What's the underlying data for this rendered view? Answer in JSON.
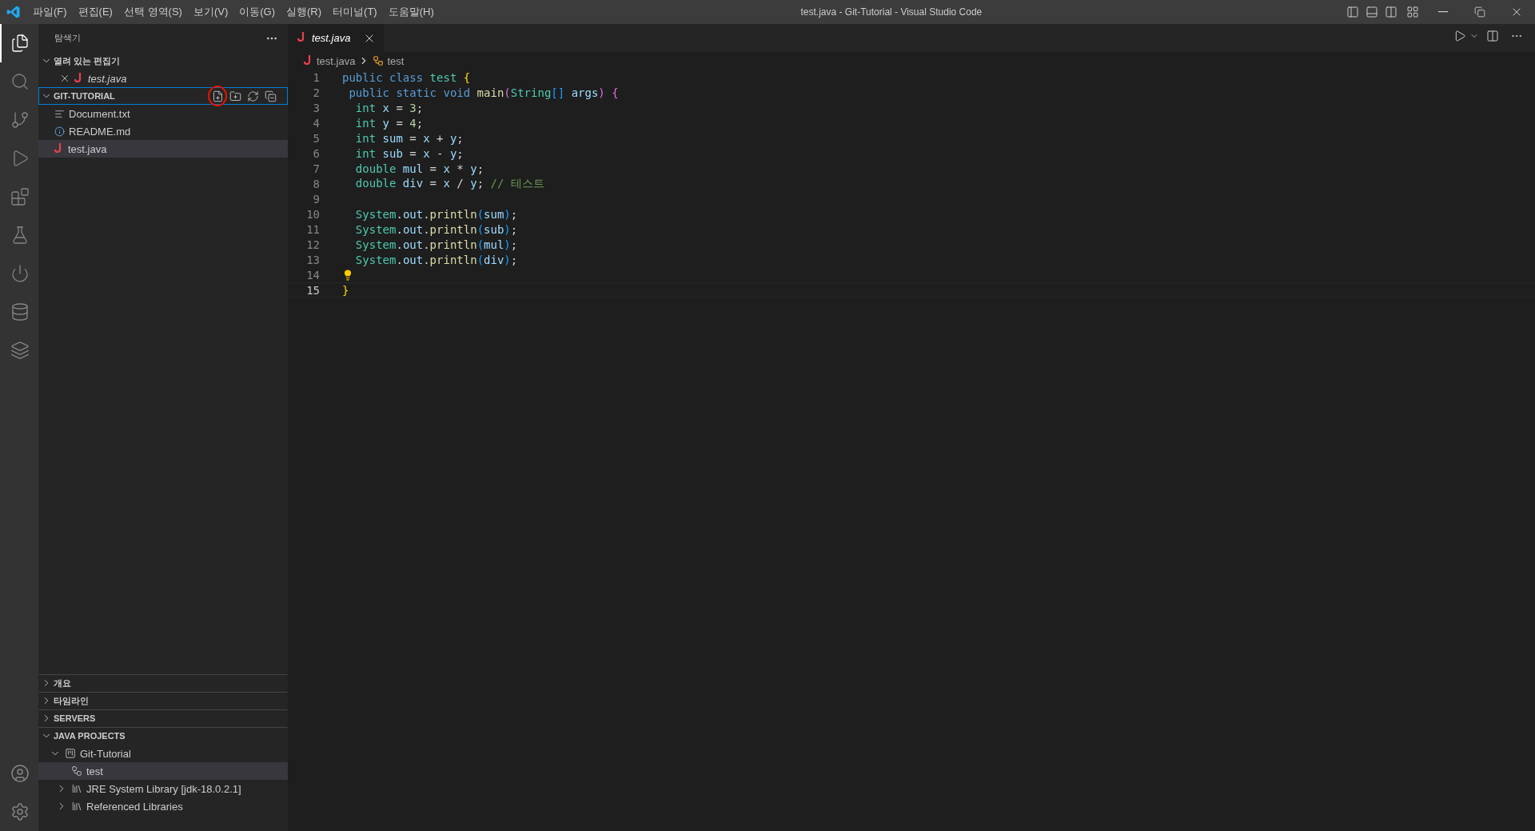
{
  "window": {
    "title": "test.java - Git-Tutorial - Visual Studio Code"
  },
  "menu": [
    "파일(F)",
    "편집(E)",
    "선택 영역(S)",
    "보기(V)",
    "이동(G)",
    "실행(R)",
    "터미널(T)",
    "도움말(H)"
  ],
  "activity_bar": {
    "items": [
      {
        "selected": true
      },
      {
        "selected": false
      },
      {
        "selected": false
      },
      {
        "selected": false
      },
      {
        "selected": false
      },
      {
        "selected": false
      },
      {
        "selected": false
      },
      {
        "selected": false
      },
      {
        "selected": false
      }
    ]
  },
  "sidebar": {
    "title": "탐색기",
    "open_editors": {
      "label": "열려 있는 편집기",
      "expanded": true,
      "files": [
        {
          "name": "test.java",
          "kind": "java",
          "preview": true
        }
      ]
    },
    "folder": {
      "label": "GIT-TUTORIAL",
      "expanded": true,
      "focused": true,
      "actions": [
        {
          "highlighted": true
        },
        {
          "highlighted": false
        },
        {
          "highlighted": false
        },
        {
          "highlighted": false
        }
      ],
      "files": [
        {
          "name": "Document.txt",
          "kind": "text",
          "selected": false
        },
        {
          "name": "README.md",
          "kind": "info",
          "selected": false
        },
        {
          "name": "test.java",
          "kind": "java",
          "selected": true
        }
      ]
    },
    "panels": [
      {
        "label": "개요",
        "expanded": false
      },
      {
        "label": "타임라인",
        "expanded": false
      },
      {
        "label": "SERVERS",
        "expanded": false
      },
      {
        "label": "JAVA PROJECTS",
        "expanded": true,
        "tree": [
          {
            "name": "Git-Tutorial",
            "kind": "project",
            "expanded": true,
            "selected": false,
            "children": [
              {
                "name": "test",
                "kind": "class",
                "selected": true
              },
              {
                "name": "JRE System Library [jdk-18.0.2.1]",
                "kind": "library",
                "expanded": false,
                "selected": false
              },
              {
                "name": "Referenced Libraries",
                "kind": "library",
                "expanded": false,
                "selected": false
              }
            ]
          }
        ]
      }
    ]
  },
  "editor": {
    "tabs": [
      {
        "label": "test.java",
        "selected": true,
        "preview": true
      }
    ],
    "breadcrumb": [
      "test.java",
      "test"
    ],
    "lines": [
      {
        "number": "1",
        "tokens": [
          {
            "text": "public ",
            "kind": "keyword"
          },
          {
            "text": "class ",
            "kind": "keyword"
          },
          {
            "text": "test ",
            "kind": "type"
          },
          {
            "text": "{",
            "kind": "bracket1"
          }
        ]
      },
      {
        "number": "2",
        "tokens": [
          {
            "text": " public ",
            "kind": "keyword"
          },
          {
            "text": "static ",
            "kind": "keyword"
          },
          {
            "text": "void ",
            "kind": "keyword"
          },
          {
            "text": "main",
            "kind": "function"
          },
          {
            "text": "(",
            "kind": "bracket2"
          },
          {
            "text": "String",
            "kind": "type"
          },
          {
            "text": "[]",
            "kind": "bracket3"
          },
          {
            "text": " args",
            "kind": "variable"
          },
          {
            "text": ") {",
            "kind": "bracket2"
          }
        ]
      },
      {
        "number": "3",
        "tokens": [
          {
            "text": "  int ",
            "kind": "type"
          },
          {
            "text": "x",
            "kind": "variable"
          },
          {
            "text": " = ",
            "kind": "plain"
          },
          {
            "text": "3",
            "kind": "number"
          },
          {
            "text": ";",
            "kind": "plain"
          }
        ]
      },
      {
        "number": "4",
        "tokens": [
          {
            "text": "  int ",
            "kind": "type"
          },
          {
            "text": "y",
            "kind": "variable"
          },
          {
            "text": " = ",
            "kind": "plain"
          },
          {
            "text": "4",
            "kind": "number"
          },
          {
            "text": ";",
            "kind": "plain"
          }
        ]
      },
      {
        "number": "5",
        "tokens": [
          {
            "text": "  int ",
            "kind": "type"
          },
          {
            "text": "sum",
            "kind": "variable"
          },
          {
            "text": " = ",
            "kind": "plain"
          },
          {
            "text": "x",
            "kind": "variable"
          },
          {
            "text": " + ",
            "kind": "plain"
          },
          {
            "text": "y",
            "kind": "variable"
          },
          {
            "text": ";",
            "kind": "plain"
          }
        ]
      },
      {
        "number": "6",
        "tokens": [
          {
            "text": "  int ",
            "kind": "type"
          },
          {
            "text": "sub",
            "kind": "variable"
          },
          {
            "text": " = ",
            "kind": "plain"
          },
          {
            "text": "x",
            "kind": "variable"
          },
          {
            "text": " - ",
            "kind": "plain"
          },
          {
            "text": "y",
            "kind": "variable"
          },
          {
            "text": ";",
            "kind": "plain"
          }
        ]
      },
      {
        "number": "7",
        "tokens": [
          {
            "text": "  double ",
            "kind": "type"
          },
          {
            "text": "mul",
            "kind": "variable"
          },
          {
            "text": " = ",
            "kind": "plain"
          },
          {
            "text": "x",
            "kind": "variable"
          },
          {
            "text": " * ",
            "kind": "plain"
          },
          {
            "text": "y",
            "kind": "variable"
          },
          {
            "text": ";",
            "kind": "plain"
          }
        ]
      },
      {
        "number": "8",
        "tokens": [
          {
            "text": "  double ",
            "kind": "type"
          },
          {
            "text": "div",
            "kind": "variable"
          },
          {
            "text": " = ",
            "kind": "plain"
          },
          {
            "text": "x",
            "kind": "variable"
          },
          {
            "text": " / ",
            "kind": "plain"
          },
          {
            "text": "y",
            "kind": "variable"
          },
          {
            "text": "; ",
            "kind": "plain"
          },
          {
            "text": "// 테스트",
            "kind": "comment"
          }
        ]
      },
      {
        "number": "9"
      },
      {
        "number": "10",
        "tokens": [
          {
            "text": "  System",
            "kind": "type"
          },
          {
            "text": ".",
            "kind": "plain"
          },
          {
            "text": "out",
            "kind": "variable"
          },
          {
            "text": ".",
            "kind": "plain"
          },
          {
            "text": "println",
            "kind": "function"
          },
          {
            "text": "(",
            "kind": "bracket3"
          },
          {
            "text": "sum",
            "kind": "variable"
          },
          {
            "text": ")",
            "kind": "bracket3"
          },
          {
            "text": ";",
            "kind": "plain"
          }
        ]
      },
      {
        "number": "11",
        "tokens": [
          {
            "text": "  System",
            "kind": "type"
          },
          {
            "text": ".",
            "kind": "plain"
          },
          {
            "text": "out",
            "kind": "variable"
          },
          {
            "text": ".",
            "kind": "plain"
          },
          {
            "text": "println",
            "kind": "function"
          },
          {
            "text": "(",
            "kind": "bracket3"
          },
          {
            "text": "sub",
            "kind": "variable"
          },
          {
            "text": ")",
            "kind": "bracket3"
          },
          {
            "text": ";",
            "kind": "plain"
          }
        ]
      },
      {
        "number": "12",
        "tokens": [
          {
            "text": "  System",
            "kind": "type"
          },
          {
            "text": ".",
            "kind": "plain"
          },
          {
            "text": "out",
            "kind": "variable"
          },
          {
            "text": ".",
            "kind": "plain"
          },
          {
            "text": "println",
            "kind": "function"
          },
          {
            "text": "(",
            "kind": "bracket3"
          },
          {
            "text": "mul",
            "kind": "variable"
          },
          {
            "text": ")",
            "kind": "bracket3"
          },
          {
            "text": ";",
            "kind": "plain"
          }
        ]
      },
      {
        "number": "13",
        "tokens": [
          {
            "text": "  System",
            "kind": "type"
          },
          {
            "text": ".",
            "kind": "plain"
          },
          {
            "text": "out",
            "kind": "variable"
          },
          {
            "text": ".",
            "kind": "plain"
          },
          {
            "text": "println",
            "kind": "function"
          },
          {
            "text": "(",
            "kind": "bracket3"
          },
          {
            "text": "div",
            "kind": "variable"
          },
          {
            "text": ")",
            "kind": "bracket3"
          },
          {
            "text": ";",
            "kind": "plain"
          }
        ]
      },
      {
        "number": "14",
        "lightbulb": true
      },
      {
        "number": "15",
        "current": true,
        "tokens": [
          {
            "text": "}",
            "kind": "bracket1"
          }
        ]
      }
    ]
  }
}
